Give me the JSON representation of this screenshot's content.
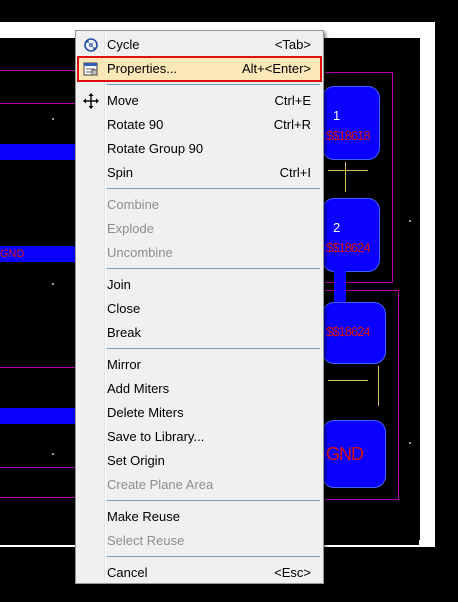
{
  "menu": {
    "items": [
      {
        "label": "Cycle",
        "shortcut": "<Tab>",
        "icon": "cycle-icon",
        "enabled": true
      },
      {
        "label": "Properties...",
        "shortcut": "Alt+<Enter>",
        "icon": "properties-icon",
        "enabled": true,
        "highlighted": true
      },
      {
        "label": "Move",
        "shortcut": "Ctrl+E",
        "icon": "move-icon",
        "enabled": true
      },
      {
        "label": "Rotate 90",
        "shortcut": "Ctrl+R",
        "enabled": true
      },
      {
        "label": "Rotate Group 90",
        "shortcut": "",
        "enabled": true
      },
      {
        "label": "Spin",
        "shortcut": "Ctrl+I",
        "enabled": true
      },
      {
        "label": "Combine",
        "shortcut": "",
        "enabled": false
      },
      {
        "label": "Explode",
        "shortcut": "",
        "enabled": false
      },
      {
        "label": "Uncombine",
        "shortcut": "",
        "enabled": false
      },
      {
        "label": "Join",
        "shortcut": "",
        "enabled": true
      },
      {
        "label": "Close",
        "shortcut": "",
        "enabled": true
      },
      {
        "label": "Break",
        "shortcut": "",
        "enabled": true
      },
      {
        "label": "Mirror",
        "shortcut": "",
        "enabled": true
      },
      {
        "label": "Add Miters",
        "shortcut": "",
        "enabled": true
      },
      {
        "label": "Delete Miters",
        "shortcut": "",
        "enabled": true
      },
      {
        "label": "Save to Library...",
        "shortcut": "",
        "enabled": true
      },
      {
        "label": "Set Origin",
        "shortcut": "",
        "enabled": true
      },
      {
        "label": "Create Plane Area",
        "shortcut": "",
        "enabled": false
      },
      {
        "label": "Make Reuse",
        "shortcut": "",
        "enabled": true
      },
      {
        "label": "Select Reuse",
        "shortcut": "",
        "enabled": false
      },
      {
        "label": "Cancel",
        "shortcut": "<Esc>",
        "enabled": true
      }
    ]
  },
  "canvas": {
    "pads": [
      {
        "number": "1",
        "net": "$$18618"
      },
      {
        "number": "2",
        "net": "$$18624"
      },
      {
        "number": "",
        "net": "$$18624"
      },
      {
        "number": "",
        "net": "GND"
      }
    ],
    "left_net_label": "GND"
  },
  "colors": {
    "highlight_fill": "#fbe8b8",
    "highlight_border": "#e01010",
    "trace": "#0a00ff",
    "outline": "#b000b0",
    "net_label": "#d41010"
  }
}
